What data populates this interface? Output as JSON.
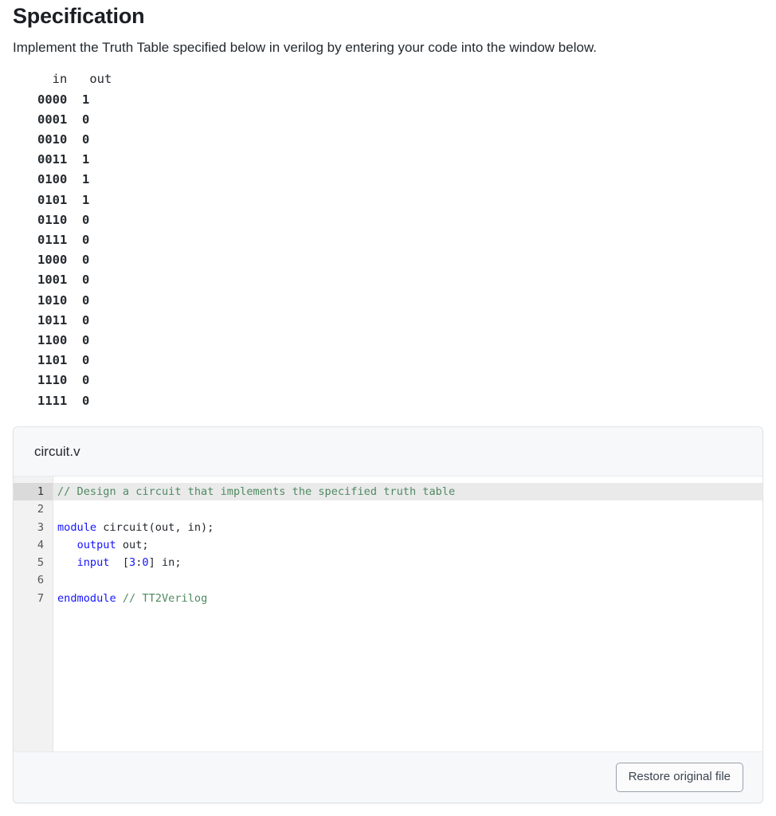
{
  "heading": "Specification",
  "intro": "Implement the Truth Table specified below in verilog by entering your code into the window below.",
  "truth_table": {
    "columns": [
      "in",
      "out"
    ],
    "header_line": "  in   out",
    "rows": [
      {
        "in": "0000",
        "out": "1"
      },
      {
        "in": "0001",
        "out": "0"
      },
      {
        "in": "0010",
        "out": "0"
      },
      {
        "in": "0011",
        "out": "1"
      },
      {
        "in": "0100",
        "out": "1"
      },
      {
        "in": "0101",
        "out": "1"
      },
      {
        "in": "0110",
        "out": "0"
      },
      {
        "in": "0111",
        "out": "0"
      },
      {
        "in": "1000",
        "out": "0"
      },
      {
        "in": "1001",
        "out": "0"
      },
      {
        "in": "1010",
        "out": "0"
      },
      {
        "in": "1011",
        "out": "0"
      },
      {
        "in": "1100",
        "out": "0"
      },
      {
        "in": "1101",
        "out": "0"
      },
      {
        "in": "1110",
        "out": "0"
      },
      {
        "in": "1111",
        "out": "0"
      }
    ]
  },
  "editor": {
    "filename": "circuit.v",
    "active_line": 1,
    "line_numbers": [
      "1",
      "2",
      "3",
      "4",
      "5",
      "6",
      "7"
    ],
    "lines": [
      {
        "n": "1",
        "text": "// Design a circuit that implements the specified truth table"
      },
      {
        "n": "2",
        "text": ""
      },
      {
        "n": "3",
        "text": "module circuit(out, in);"
      },
      {
        "n": "4",
        "text": "   output out;"
      },
      {
        "n": "5",
        "text": "   input  [3:0] in;"
      },
      {
        "n": "6",
        "text": ""
      },
      {
        "n": "7",
        "text": "endmodule // TT2Verilog"
      }
    ],
    "syntax_colors": {
      "keyword": "#1515ff",
      "comment": "#4f8a62",
      "number": "#1515ff",
      "text": "#24292e"
    },
    "footer": {
      "restore_label": "Restore original file"
    }
  }
}
